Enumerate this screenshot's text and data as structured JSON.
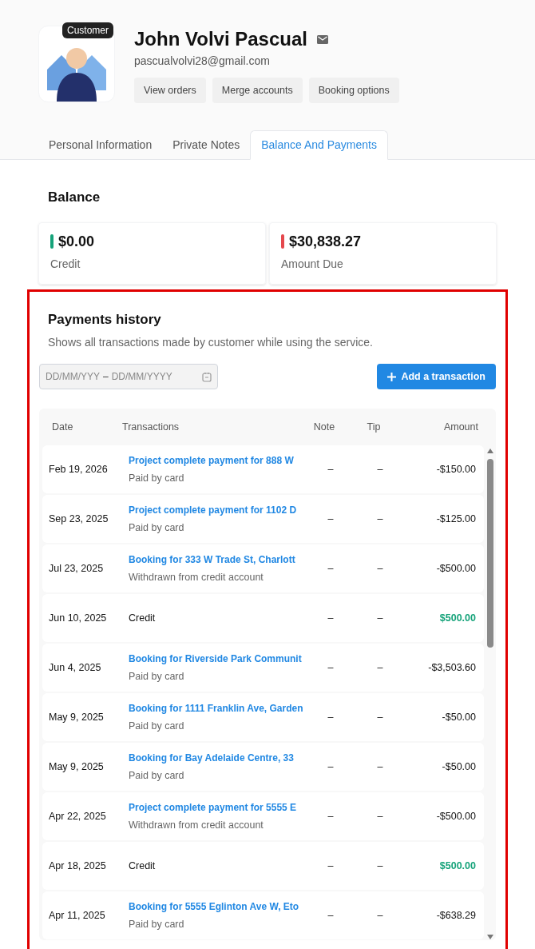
{
  "profile": {
    "badge": "Customer",
    "name": "John Volvi Pascual",
    "email": "pascualvolvi28@gmail.com",
    "actions": [
      "View orders",
      "Merge accounts",
      "Booking options"
    ]
  },
  "tabs": [
    {
      "label": "Personal Information",
      "selected": false
    },
    {
      "label": "Private Notes",
      "selected": false
    },
    {
      "label": "Balance And Payments",
      "selected": true
    }
  ],
  "balance": {
    "title": "Balance",
    "cards": [
      {
        "value": "$0.00",
        "label": "Credit",
        "color": "#16a37a"
      },
      {
        "value": "$30,838.27",
        "label": "Amount Due",
        "color": "#e5484d"
      }
    ]
  },
  "payments": {
    "title": "Payments history",
    "subtitle": "Shows all transactions made by customer while using the service.",
    "date_range": {
      "start_placeholder": "DD/MM/YYY",
      "separator": "–",
      "end_placeholder": "DD/MM/YYYY"
    },
    "add_button": "Add a transaction",
    "table": {
      "columns": [
        "Date",
        "Transactions",
        "Note",
        "Tip",
        "Amount"
      ],
      "rows": [
        {
          "kind": "transaction",
          "date": "Feb 19, 2026",
          "title": "Project complete payment for 888 W",
          "method": "Paid by card",
          "note": "–",
          "tip": "–",
          "amount": "-$150.00"
        },
        {
          "kind": "transaction",
          "date": "Sep 23, 2025",
          "title": "Project complete payment for 1102 D",
          "method": "Paid by card",
          "note": "–",
          "tip": "–",
          "amount": "-$125.00"
        },
        {
          "kind": "transaction",
          "date": "Jul 23, 2025",
          "title": "Booking for 333 W Trade St, Charlott",
          "method": "Withdrawn from credit account",
          "note": "–",
          "tip": "–",
          "amount": "-$500.00"
        },
        {
          "kind": "credit",
          "date": "Jun 10, 2025",
          "title": "Credit",
          "note": "–",
          "tip": "–",
          "amount": "$500.00"
        },
        {
          "kind": "transaction",
          "date": "Jun 4, 2025",
          "title": "Booking for Riverside Park Communit",
          "method": "Paid by card",
          "note": "–",
          "tip": "–",
          "amount": "-$3,503.60"
        },
        {
          "kind": "transaction",
          "date": "May 9, 2025",
          "title": "Booking for 1111 Franklin Ave, Garden",
          "method": "Paid by card",
          "note": "–",
          "tip": "–",
          "amount": "-$50.00"
        },
        {
          "kind": "transaction",
          "date": "May 9, 2025",
          "title": "Booking for Bay Adelaide Centre, 33",
          "method": "Paid by card",
          "note": "–",
          "tip": "–",
          "amount": "-$50.00"
        },
        {
          "kind": "transaction",
          "date": "Apr 22, 2025",
          "title": "Project complete payment for 5555 E",
          "method": "Withdrawn from credit account",
          "note": "–",
          "tip": "–",
          "amount": "-$500.00"
        },
        {
          "kind": "credit",
          "date": "Apr 18, 2025",
          "title": "Credit",
          "note": "–",
          "tip": "–",
          "amount": "$500.00"
        },
        {
          "kind": "transaction",
          "date": "Apr 11, 2025",
          "title": "Booking for 5555 Eglinton Ave W, Eto",
          "method": "Paid by card",
          "note": "–",
          "tip": "–",
          "amount": "-$638.29"
        }
      ]
    }
  }
}
